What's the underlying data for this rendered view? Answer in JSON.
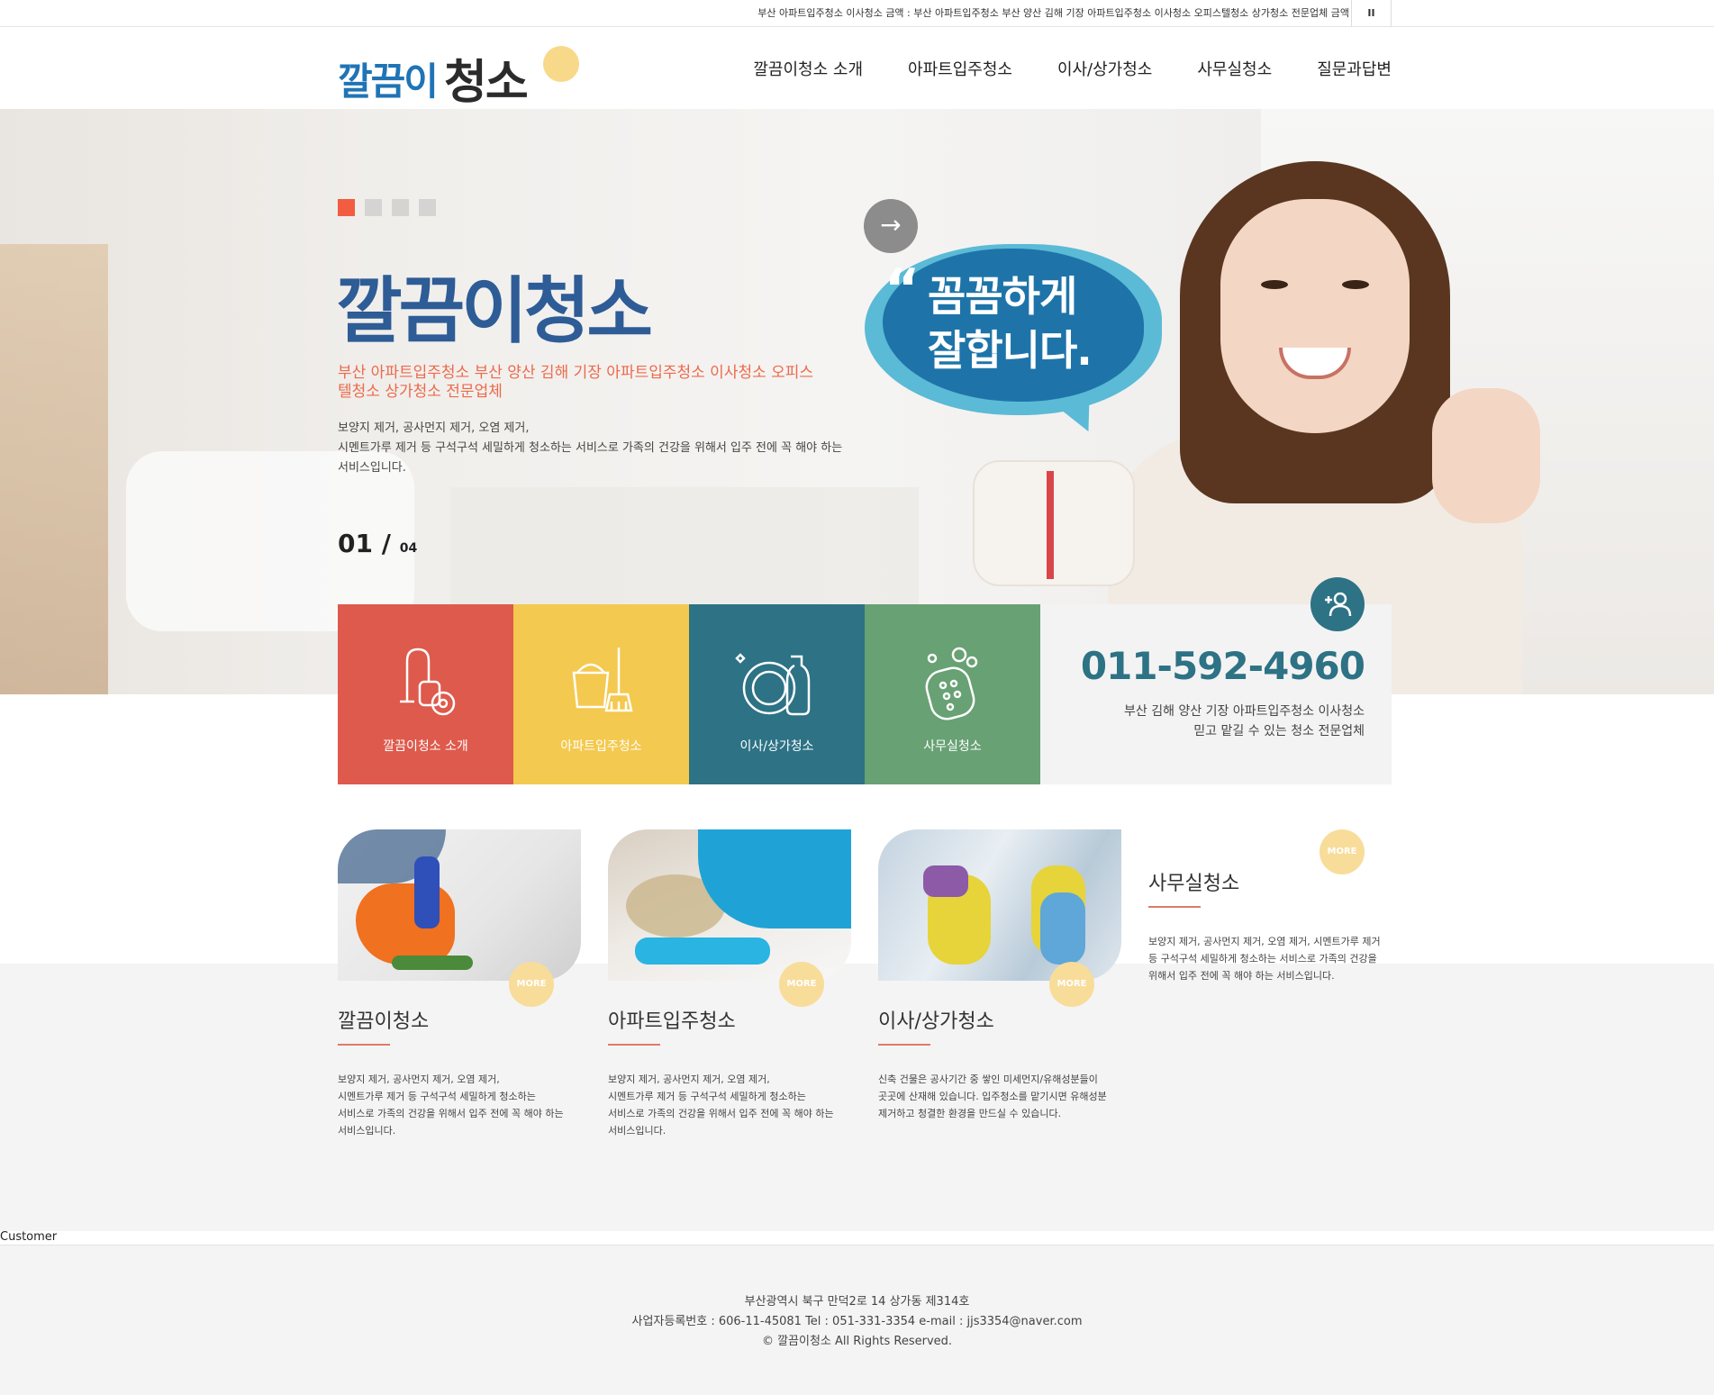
{
  "topbar": {
    "ticker": "부산 아파트입주청소 이사청소 금액 : 부산 아파트입주청소 부산 양산 김해 기장 아파트입주청소 이사청소 오피스텔청소 상가청소 전문업체 금액",
    "pause": "II"
  },
  "header": {
    "logo_part1": "깔끔이",
    "logo_part2": "청소",
    "nav": [
      "깔끔이청소 소개",
      "아파트입주청소",
      "이사/상가청소",
      "사무실청소",
      "질문과답변"
    ]
  },
  "hero": {
    "title": "깔끔이청소",
    "subtitle": "부산 아파트입주청소 부산 양산 김해 기장 아파트입주청소 이사청소 오피스텔청소 상가청소 전문업체",
    "desc_line1": "보양지 제거, 공사먼지 제거, 오염 제거,",
    "desc_line2": "시멘트가루 제거 등 구석구석 세밀하게 청소하는 서비스로 가족의 건강을 위해서 입주 전에 꼭 해야 하는",
    "desc_line3": "서비스입니다.",
    "counter_current": "01",
    "counter_sep": "/",
    "counter_total": "04",
    "bubble_quote": "“",
    "bubble_line1": "꼼꼼하게",
    "bubble_line2": "잘합니다.",
    "arrow": "→"
  },
  "tiles": [
    {
      "label": "깔끔이청소 소개",
      "icon": "vacuum-cleaner-icon",
      "color": "#de5a4c"
    },
    {
      "label": "아파트입주청소",
      "icon": "bucket-broom-icon",
      "color": "#f4c94f"
    },
    {
      "label": "이사/상가청소",
      "icon": "dish-spray-icon",
      "color": "#2d7285"
    },
    {
      "label": "사무실청소",
      "icon": "sponge-bubbles-icon",
      "color": "#68a174"
    }
  ],
  "contact": {
    "icon": "add-user-icon",
    "phone": "011-592-4960",
    "desc1": "부산 김해 양산 기장 아파트입주청소 이사청소",
    "desc2": "믿고 맡길 수 있는 청소 전문업체"
  },
  "cards": [
    {
      "title": "깔끔이청소",
      "more": "MORE",
      "desc1": "보양지 제거, 공사먼지 제거, 오염 제거,",
      "desc2": "시멘트가루 제거 등 구석구석 세밀하게 청소하는",
      "desc3": "서비스로 가족의 건강을 위해서 입주 전에 꼭 해야 하는",
      "desc4": "서비스입니다."
    },
    {
      "title": "아파트입주청소",
      "more": "MORE",
      "desc1": "보양지 제거, 공사먼지 제거, 오염 제거,",
      "desc2": "시멘트가루 제거 등 구석구석 세밀하게 청소하는",
      "desc3": "서비스로 가족의 건강을 위해서 입주 전에 꼭 해야 하는",
      "desc4": "서비스입니다."
    },
    {
      "title": "이사/상가청소",
      "more": "MORE",
      "desc1": "신축 건물은 공사기간 중 쌓인 미세먼지/유해성분들이",
      "desc2": "곳곳에 산재해 있습니다. 입주청소를 맡기시면 유해성분",
      "desc3": "제거하고 청결한 환경을 만드실 수 있습니다."
    },
    {
      "title": "사무실청소",
      "more": "MORE",
      "desc1": "보양지 제거, 공사먼지 제거, 오염 제거, 시멘트가루 제거",
      "desc2": "등 구석구석 세밀하게 청소하는 서비스로 가족의 건강을",
      "desc3": "위해서 입주 전에 꼭 해야 하는 서비스입니다."
    }
  ],
  "customer_label": "Customer",
  "footer": {
    "address": "부산광역시 북구 만덕2로 14 상가동 제314호",
    "info": "사업자등록번호 : 606-11-45081   Tel : 051-331-3354   e-mail : jjs3354@naver.com",
    "copyright": "© 깔끔이청소 All Rights Reserved."
  }
}
